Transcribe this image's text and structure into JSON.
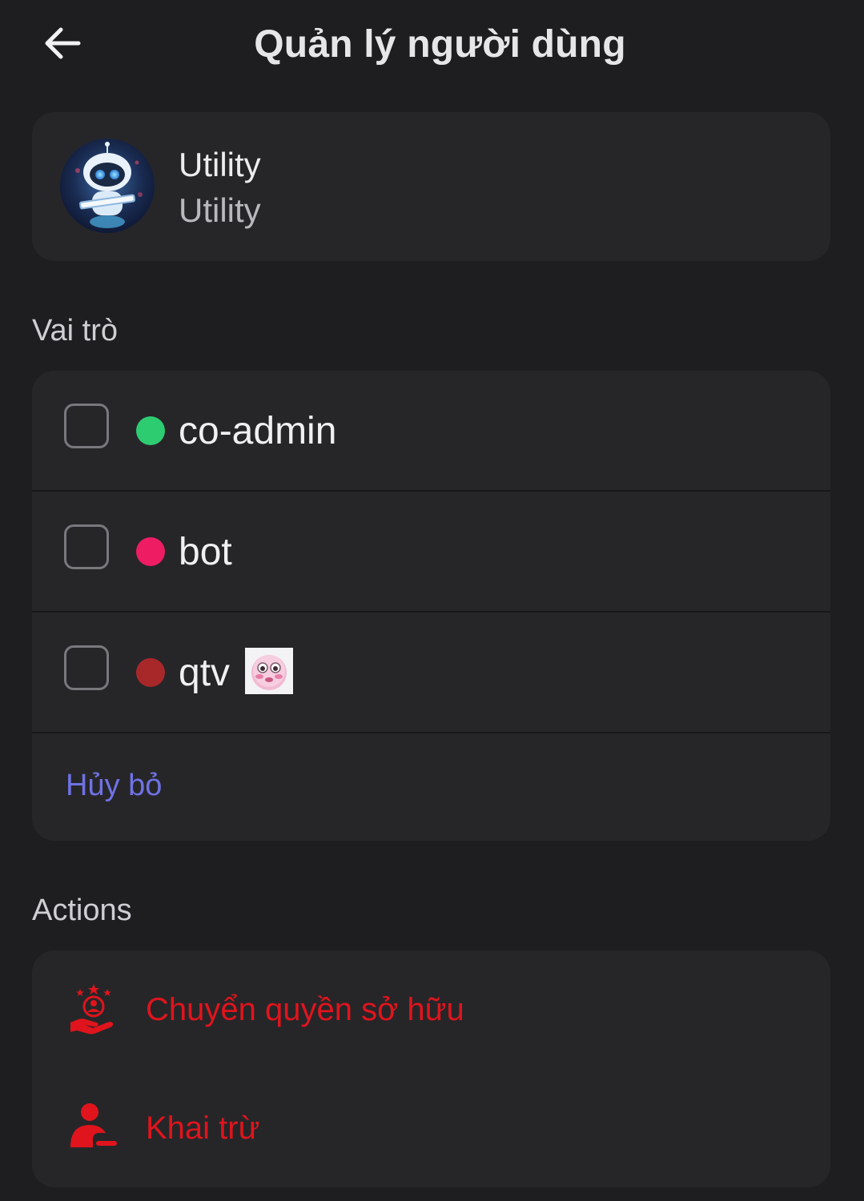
{
  "header": {
    "back_icon": "arrow-left-icon",
    "title": "Quản lý người dùng"
  },
  "user": {
    "name": "Utility",
    "subtitle": "Utility",
    "avatar_icon": "robot-avatar"
  },
  "roles_section": {
    "label": "Vai trò",
    "roles": [
      {
        "label": "co-admin",
        "color": "#2ecc71",
        "checked": false
      },
      {
        "label": "bot",
        "color": "#ee1d63",
        "checked": false
      },
      {
        "label": "qtv",
        "color": "#a8282a",
        "checked": false,
        "icon": "blushing-face-emoji"
      }
    ],
    "cancel_label": "Hủy bỏ"
  },
  "actions_section": {
    "label": "Actions",
    "items": [
      {
        "label": "Chuyển quyền sở hữu",
        "icon": "transfer-ownership-icon"
      },
      {
        "label": "Khai trừ",
        "icon": "kick-user-icon"
      }
    ],
    "danger_color": "#e0141c"
  },
  "theme": {
    "background": "#1e1e21",
    "card": "#262629",
    "link": "#6f72e4"
  }
}
